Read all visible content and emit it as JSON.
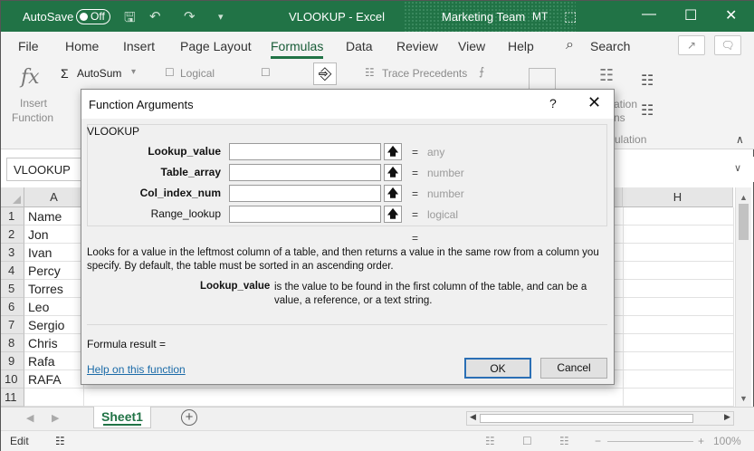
{
  "titlebar": {
    "autosave_label": "AutoSave",
    "autosave_state": "Off",
    "doc_title": "VLOOKUP  -  Excel",
    "team": "Marketing Team",
    "initials": "MT",
    "minimize": "—",
    "restore": "☐",
    "close": "✕",
    "accent": "#217346"
  },
  "ribbon_tabs": [
    "File",
    "Home",
    "Insert",
    "Page Layout",
    "Formulas",
    "Data",
    "Review",
    "View",
    "Help"
  ],
  "active_tab": "Formulas",
  "search": {
    "label": "Search"
  },
  "ribbon": {
    "insert_function": [
      "Insert",
      "Function"
    ],
    "autosum": "AutoSum",
    "logical": "Logical",
    "trace_precedents": "Trace Precedents",
    "calc_partial_1": "ation",
    "calc_partial_2": "ns",
    "calc_partial_3": "ulation"
  },
  "formula_bar": {
    "name_box": "VLOOKUP"
  },
  "grid": {
    "col_a": "A",
    "col_h": "H",
    "rows": [
      "1",
      "2",
      "3",
      "4",
      "5",
      "6",
      "7",
      "8",
      "9",
      "10",
      "11"
    ],
    "col_a_values": [
      "Name",
      "Jon",
      "Ivan",
      "Percy",
      "Torres",
      "Leo",
      "Sergio",
      "Chris",
      "Rafa",
      "RAFA",
      ""
    ]
  },
  "sheets": {
    "active": "Sheet1",
    "add": "+"
  },
  "status": {
    "mode": "Edit",
    "zoom": "100%"
  },
  "dialog": {
    "title": "Function Arguments",
    "help_icon": "?",
    "close_icon": "✕",
    "function_name": "VLOOKUP",
    "args": [
      {
        "label": "Lookup_value",
        "value": "",
        "eq": "=",
        "hint": "any"
      },
      {
        "label": "Table_array",
        "value": "",
        "eq": "=",
        "hint": "number"
      },
      {
        "label": "Col_index_num",
        "value": "",
        "eq": "=",
        "hint": "number"
      },
      {
        "label": "Range_lookup",
        "value": "",
        "eq": "=",
        "hint": "logical"
      }
    ],
    "result_eq": "=",
    "description": "Looks for a value in the leftmost column of a table, and then returns a value in the same row from a column you specify. By default, the table must be sorted in an ascending order.",
    "arg_desc_label": "Lookup_value",
    "arg_desc": "is the value to be found in the first column of the table, and can be a value, a reference, or a text string.",
    "formula_result": "Formula result =",
    "help_link": "Help on this function",
    "ok": "OK",
    "cancel": "Cancel"
  }
}
